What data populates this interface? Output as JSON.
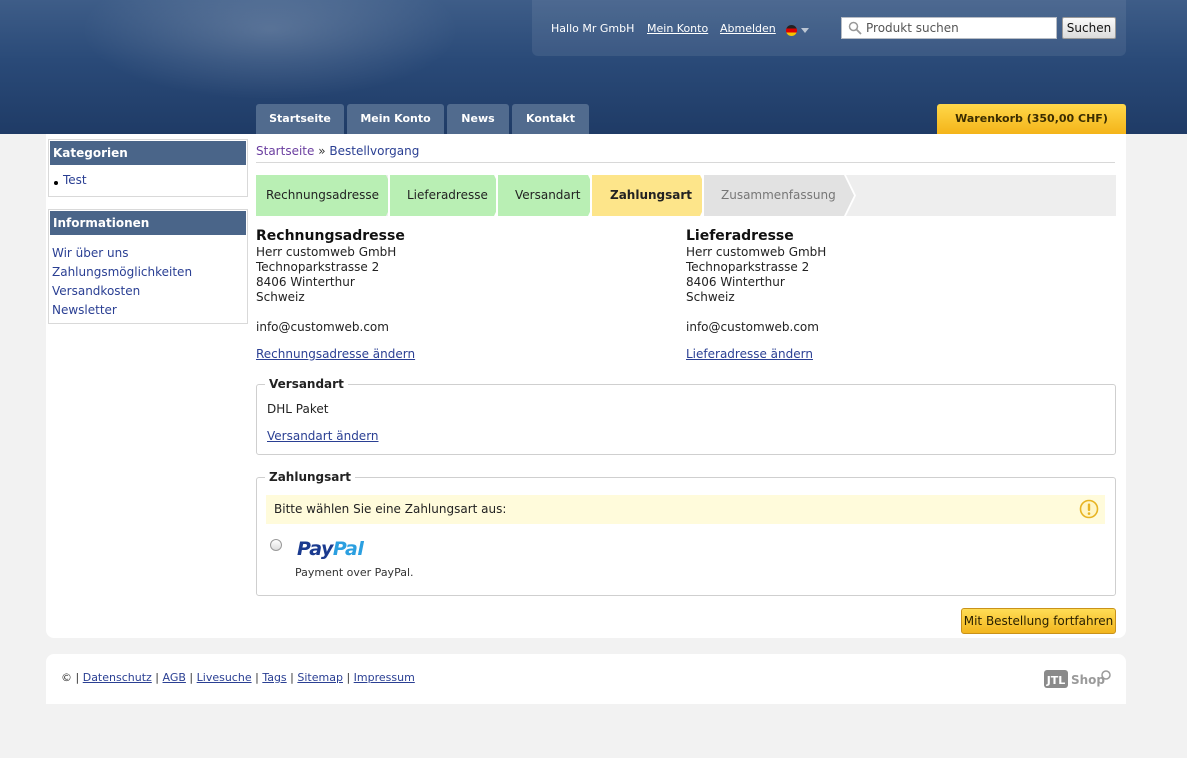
{
  "header": {
    "greeting": "Hallo Mr GmbH",
    "my_account_link": "Mein Konto",
    "logout_link": "Abmelden",
    "language_flag": "german-flag-icon",
    "search": {
      "placeholder": "Produkt suchen",
      "button": "Suchen"
    },
    "nav": [
      "Startseite",
      "Mein Konto",
      "News",
      "Kontakt"
    ],
    "cart": "Warenkorb (350,00 CHF)",
    "colors": {
      "header_bg": "#2a4a78",
      "tab_bg": "#516b8e",
      "cart_bg": "#f4b419"
    }
  },
  "sidebar": {
    "categories": {
      "title": "Kategorien",
      "items": [
        "Test"
      ]
    },
    "information": {
      "title": "Informationen",
      "items": [
        "Wir über uns",
        "Zahlungsmöglichkeiten",
        "Versandkosten",
        "Newsletter"
      ]
    }
  },
  "breadcrumb": {
    "home": "Startseite",
    "separator": "»",
    "current": "Bestellvorgang"
  },
  "steps": [
    {
      "label": "Rechnungsadresse",
      "state": "done"
    },
    {
      "label": "Lieferadresse",
      "state": "done"
    },
    {
      "label": "Versandart",
      "state": "done"
    },
    {
      "label": "Zahlungsart",
      "state": "active"
    },
    {
      "label": "Zusammenfassung",
      "state": "pending"
    }
  ],
  "billing": {
    "title": "Rechnungsadresse",
    "lines": [
      "Herr customweb GmbH",
      "Technoparkstrasse 2",
      "8406 Winterthur",
      "Schweiz"
    ],
    "email": "info@customweb.com",
    "change_link": "Rechnungsadresse ändern"
  },
  "shipping_address": {
    "title": "Lieferadresse",
    "lines": [
      "Herr customweb GmbH",
      "Technoparkstrasse 2",
      "8406 Winterthur",
      "Schweiz"
    ],
    "email": "info@customweb.com",
    "change_link": "Lieferadresse ändern"
  },
  "shipping_method": {
    "legend": "Versandart",
    "value": "DHL Paket",
    "change_link": "Versandart ändern"
  },
  "payment": {
    "legend": "Zahlungsart",
    "notice": "Bitte wählen Sie eine Zahlungsart aus:",
    "option_logo_text": [
      "Pay",
      "Pal"
    ],
    "option_description": "Payment over PayPal."
  },
  "continue_button": "Mit Bestellung fortfahren",
  "footer": {
    "copyright": "©",
    "separator": "|",
    "links": [
      "Datenschutz",
      "AGB",
      "Livesuche",
      "Tags",
      "Sitemap",
      "Impressum"
    ],
    "logo_text": [
      "JTL",
      "Shop"
    ]
  }
}
